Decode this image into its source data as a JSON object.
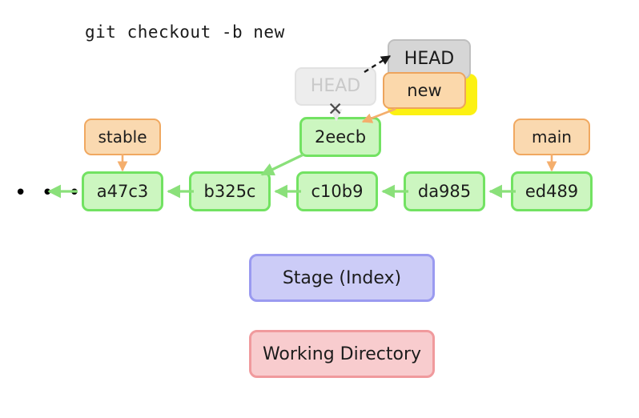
{
  "diagram": {
    "title": "git checkout -b new",
    "background_color": "#ffffff"
  },
  "colors": {
    "commit_fill": "#ccf6c0",
    "commit_border": "#72e262",
    "branch_fill": "#fad9b0",
    "branch_border": "#f0a860",
    "head_fill": "#d6d6d6",
    "head_border": "#bfbfbf",
    "head_faded_fill": "#ededed",
    "head_faded_text": "#c9c9c9",
    "highlight_yellow": "#fcf112",
    "stage_fill": "#ccccf7",
    "stage_border": "#9a9af0",
    "working_fill": "#f8ccce",
    "working_border": "#f09a9d",
    "arrow_green": "#8ae07a",
    "arrow_orange": "#f4ae6c",
    "arrow_black": "#1a1a1a"
  },
  "commits": [
    {
      "id": "a47c3",
      "label": "a47c3"
    },
    {
      "id": "b325c",
      "label": "b325c"
    },
    {
      "id": "c10b9",
      "label": "c10b9"
    },
    {
      "id": "da985",
      "label": "da985"
    },
    {
      "id": "ed489",
      "label": "ed489"
    },
    {
      "id": "2eecb",
      "label": "2eecb"
    }
  ],
  "branches": [
    {
      "id": "stable",
      "label": "stable",
      "points_to": "a47c3"
    },
    {
      "id": "main",
      "label": "main",
      "points_to": "ed489"
    },
    {
      "id": "new",
      "label": "new",
      "points_to": "2eecb"
    }
  ],
  "head": {
    "current_label": "HEAD",
    "previous_label": "HEAD",
    "detach_marker": "✕"
  },
  "areas": [
    {
      "id": "stage",
      "label": "Stage (Index)"
    },
    {
      "id": "working-directory",
      "label": "Working Directory"
    }
  ],
  "history_ellipsis": "• • •"
}
